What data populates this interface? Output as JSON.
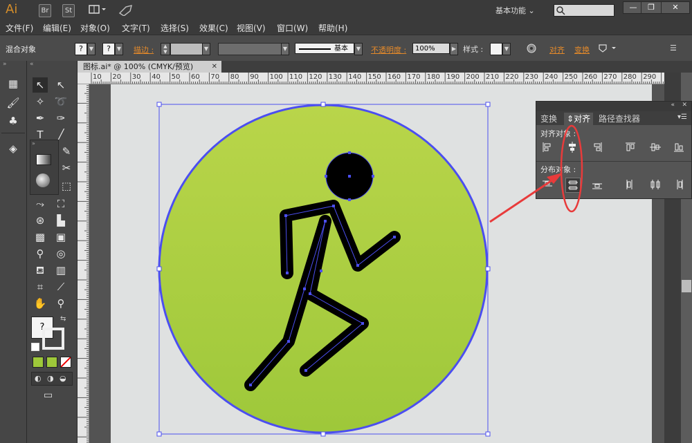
{
  "app": {
    "logo": "Ai",
    "br": "Br",
    "st": "St",
    "workspace": "基本功能"
  },
  "window_buttons": {
    "minimize": "—",
    "restore": "❐",
    "close": "✕"
  },
  "menu": [
    "文件(F)",
    "编辑(E)",
    "对象(O)",
    "文字(T)",
    "选择(S)",
    "效果(C)",
    "视图(V)",
    "窗口(W)",
    "帮助(H)"
  ],
  "control": {
    "object_type": "混合对象",
    "fill_q": "?",
    "stroke_q": "?",
    "stroke_label": "描边 :",
    "brush_label": "基本",
    "opacity_label": "不透明度 :",
    "opacity_value": "100%",
    "style_label": "样式 :",
    "align_link": "对齐",
    "transform_link": "变换"
  },
  "document": {
    "tab_title": "图标.ai* @ 100% (CMYK/预览)",
    "close": "✕"
  },
  "ruler": {
    "h": [
      "10",
      "20",
      "30",
      "40",
      "50",
      "60",
      "70",
      "80",
      "90",
      "100",
      "110",
      "120",
      "130",
      "140",
      "150",
      "160",
      "170",
      "180",
      "190",
      "200",
      "210",
      "220",
      "230",
      "240",
      "250",
      "260",
      "270",
      "280",
      "290"
    ]
  },
  "align_panel": {
    "tabs": [
      "变换",
      "对齐",
      "路径查找器"
    ],
    "align_objects": "对齐对象 :",
    "distribute_objects": "分布对象 :"
  },
  "tool_q": "?",
  "colors": {
    "circle_top": "#b9d54a",
    "circle_bottom": "#9ec83a",
    "selection": "#4b4ef0",
    "annotation": "#e83b3b"
  }
}
